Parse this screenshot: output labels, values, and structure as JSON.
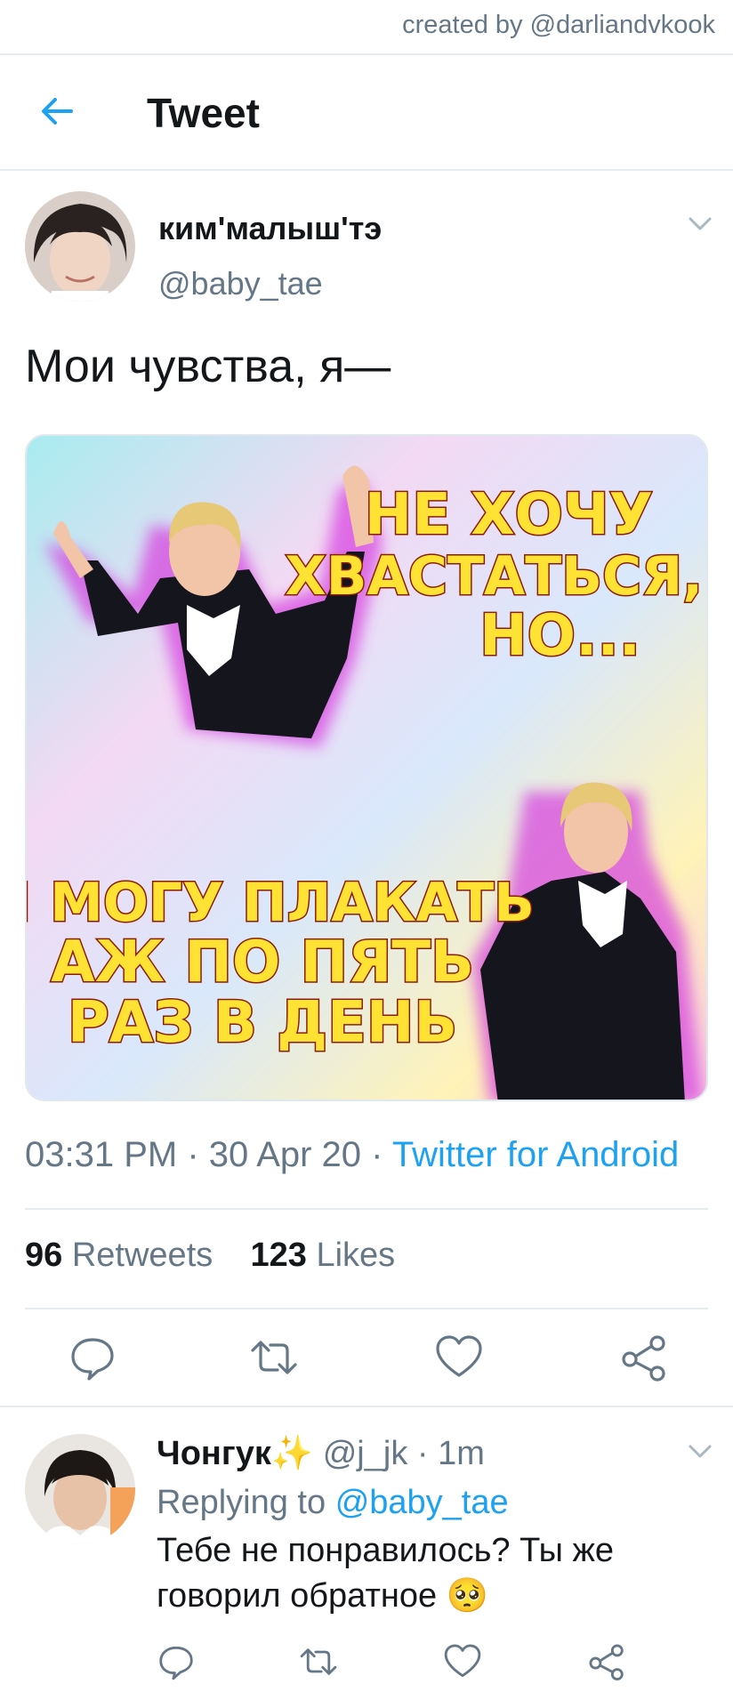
{
  "credit": "created by @darliandvkook",
  "header": {
    "title": "Tweet"
  },
  "tweet": {
    "name": "ким'малыш'тэ",
    "handle": "@baby_tae",
    "text": "Мои чувства, я—",
    "media": {
      "caption_top": [
        "НЕ ХОЧУ",
        "ХВАСТАТЬСЯ,",
        "НО..."
      ],
      "caption_bottom": [
        "Я МОГУ ПЛАКАТЬ",
        "АЖ ПО ПЯТЬ",
        "РАЗ В ДЕНЬ"
      ]
    },
    "time": "03:31 PM",
    "sep": "·",
    "date": "30 Apr 20",
    "source": "Twitter for Android",
    "retweets_count": "96",
    "retweets_label": "Retweets",
    "likes_count": "123",
    "likes_label": "Likes"
  },
  "reply": {
    "name": "Чонгук",
    "emoji_name": "✨",
    "handle": "@j_jk",
    "dot": "·",
    "time": "1m",
    "replying_prefix": "Replying to",
    "replying_handle": "@baby_tae",
    "text_line1": "Тебе не понравилось? Ты же",
    "text_line2": "говорил обратное",
    "emoji": "🥺"
  },
  "icons": {
    "back": "arrow-left-icon",
    "menu": "chevron-down-icon",
    "reply": "reply-icon",
    "retweet": "retweet-icon",
    "like": "heart-icon",
    "share": "share-icon"
  },
  "colors": {
    "accent": "#1da1f2",
    "muted": "#657786",
    "divider": "#e6ecf0",
    "caption": "#ffe233"
  }
}
